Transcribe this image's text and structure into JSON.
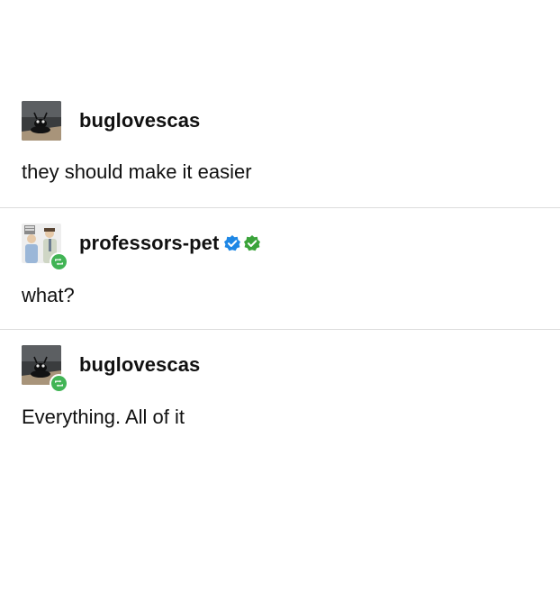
{
  "thread": [
    {
      "username": "buglovescas",
      "reblog": false,
      "verified_badges": false,
      "text": "they should make it easier"
    },
    {
      "username": "professors-pet",
      "reblog": true,
      "verified_badges": true,
      "text": "what?"
    },
    {
      "username": "buglovescas",
      "reblog": true,
      "verified_badges": false,
      "text": "Everything. All of it"
    }
  ],
  "colors": {
    "reblog_green": "#41b455",
    "verified_blue": "#1e87e5",
    "verified_green": "#3aa33a",
    "divider": "#dcdcdc"
  },
  "icons": {
    "reblog": "reblog-icon",
    "verified": "verified-badge-icon"
  }
}
